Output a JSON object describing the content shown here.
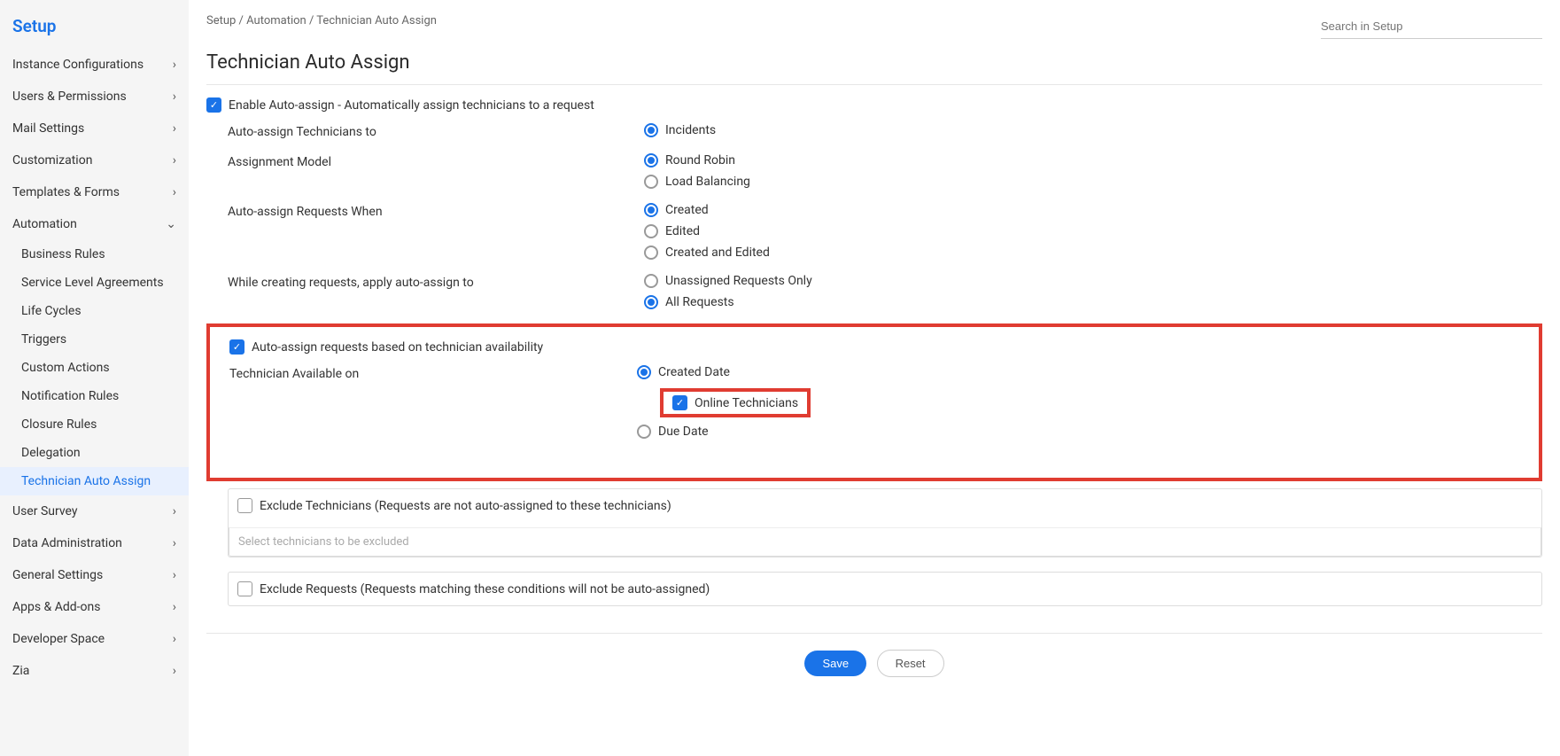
{
  "sidebar": {
    "title": "Setup",
    "items": [
      {
        "label": "Instance Configurations"
      },
      {
        "label": "Users & Permissions"
      },
      {
        "label": "Mail Settings"
      },
      {
        "label": "Customization"
      },
      {
        "label": "Templates & Forms"
      }
    ],
    "automation": {
      "label": "Automation",
      "children": [
        {
          "label": "Business Rules"
        },
        {
          "label": "Service Level Agreements"
        },
        {
          "label": "Life Cycles"
        },
        {
          "label": "Triggers"
        },
        {
          "label": "Custom Actions"
        },
        {
          "label": "Notification Rules"
        },
        {
          "label": "Closure Rules"
        },
        {
          "label": "Delegation"
        },
        {
          "label": "Technician Auto Assign"
        }
      ]
    },
    "after": [
      {
        "label": "User Survey"
      },
      {
        "label": "Data Administration"
      },
      {
        "label": "General Settings"
      },
      {
        "label": "Apps & Add-ons"
      },
      {
        "label": "Developer Space"
      },
      {
        "label": "Zia"
      }
    ]
  },
  "breadcrumb": "Setup / Automation / Technician Auto Assign",
  "search_placeholder": "Search in Setup",
  "page_title": "Technician Auto Assign",
  "enable_label": "Enable Auto-assign - Automatically assign technicians to a request",
  "form": {
    "assign_to_label": "Auto-assign Technicians to",
    "assign_to_opts": [
      "Incidents"
    ],
    "model_label": "Assignment Model",
    "model_opts": [
      "Round Robin",
      "Load Balancing"
    ],
    "when_label": "Auto-assign Requests When",
    "when_opts": [
      "Created",
      "Edited",
      "Created and Edited"
    ],
    "scope_label": "While creating requests, apply auto-assign to",
    "scope_opts": [
      "Unassigned Requests Only",
      "All Requests"
    ],
    "avail_label": "Auto-assign requests based on technician availability",
    "avail_on_label": "Technician Available on",
    "avail_on_opts": {
      "created": "Created Date",
      "online": "Online Technicians",
      "due": "Due Date"
    },
    "exclude_tech_label": "Exclude Technicians (Requests are not auto-assigned to these technicians)",
    "exclude_tech_placeholder": "Select technicians to be excluded",
    "exclude_req_label": "Exclude Requests (Requests matching these conditions will not be auto-assigned)"
  },
  "buttons": {
    "save": "Save",
    "reset": "Reset"
  }
}
